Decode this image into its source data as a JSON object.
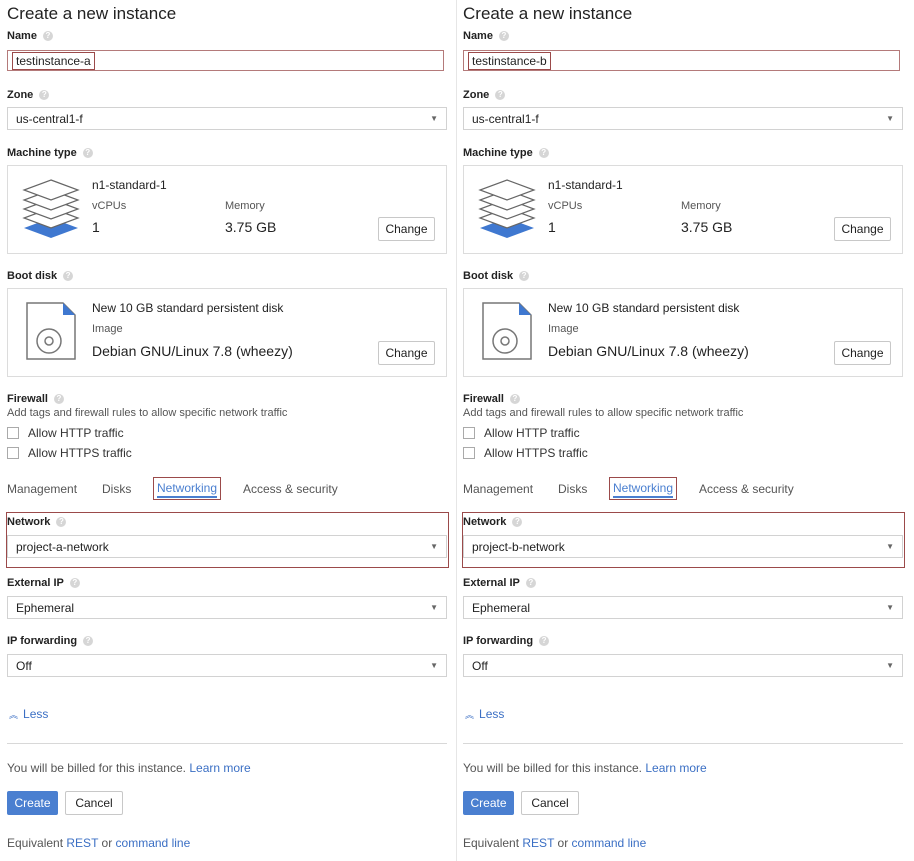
{
  "panels": [
    {
      "title": "Create a new instance",
      "name_label": "Name",
      "name_value": "testinstance-a",
      "zone_label": "Zone",
      "zone_value": "us-central1-f",
      "machine_type_label": "Machine type",
      "machine": {
        "name": "n1-standard-1",
        "vcpus_label": "vCPUs",
        "vcpus": "1",
        "memory_label": "Memory",
        "memory": "3.75 GB",
        "change": "Change"
      },
      "boot_disk_label": "Boot disk",
      "disk": {
        "title": "New 10 GB standard persistent disk",
        "image_label": "Image",
        "image": "Debian GNU/Linux 7.8 (wheezy)",
        "change": "Change"
      },
      "firewall_label": "Firewall",
      "firewall_desc": "Add tags and firewall rules to allow specific network traffic",
      "allow_http": "Allow HTTP traffic",
      "allow_https": "Allow HTTPS traffic",
      "tabs": [
        "Management",
        "Disks",
        "Networking",
        "Access & security"
      ],
      "network_label": "Network",
      "network_value": "project-a-network",
      "external_ip_label": "External IP",
      "external_ip_value": "Ephemeral",
      "ip_forwarding_label": "IP forwarding",
      "ip_forwarding_value": "Off",
      "less": "Less",
      "billed_text": "You will be billed for this instance.",
      "learn_more": "Learn more",
      "create": "Create",
      "cancel": "Cancel",
      "equivalent": "Equivalent",
      "rest": "REST",
      "or": "or",
      "command_line": "command line"
    },
    {
      "title": "Create a new instance",
      "name_label": "Name",
      "name_value": "testinstance-b",
      "zone_label": "Zone",
      "zone_value": "us-central1-f",
      "machine_type_label": "Machine type",
      "machine": {
        "name": "n1-standard-1",
        "vcpus_label": "vCPUs",
        "vcpus": "1",
        "memory_label": "Memory",
        "memory": "3.75 GB",
        "change": "Change"
      },
      "boot_disk_label": "Boot disk",
      "disk": {
        "title": "New 10 GB standard persistent disk",
        "image_label": "Image",
        "image": "Debian GNU/Linux 7.8 (wheezy)",
        "change": "Change"
      },
      "firewall_label": "Firewall",
      "firewall_desc": "Add tags and firewall rules to allow specific network traffic",
      "allow_http": "Allow HTTP traffic",
      "allow_https": "Allow HTTPS traffic",
      "tabs": [
        "Management",
        "Disks",
        "Networking",
        "Access & security"
      ],
      "network_label": "Network",
      "network_value": "project-b-network",
      "external_ip_label": "External IP",
      "external_ip_value": "Ephemeral",
      "ip_forwarding_label": "IP forwarding",
      "ip_forwarding_value": "Off",
      "less": "Less",
      "billed_text": "You will be billed for this instance.",
      "learn_more": "Learn more",
      "create": "Create",
      "cancel": "Cancel",
      "equivalent": "Equivalent",
      "rest": "REST",
      "or": "or",
      "command_line": "command line"
    }
  ],
  "colors": {
    "accent": "#4a7fd0",
    "highlight_box": "#9b4a4a"
  }
}
